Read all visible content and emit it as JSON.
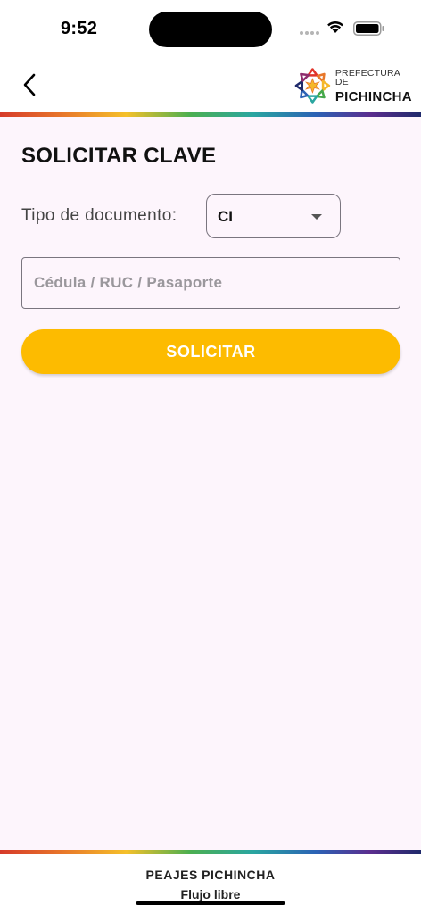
{
  "status_bar": {
    "time": "9:52"
  },
  "header": {
    "logo": {
      "line1": "PREFECTURA DE",
      "line2": "PICHINCHA"
    }
  },
  "form": {
    "title": "SOLICITAR CLAVE",
    "doc_type_label": "Tipo de documento:",
    "doc_type_value": "CI",
    "id_placeholder": "Cédula / RUC / Pasaporte",
    "submit_label": "SOLICITAR"
  },
  "footer": {
    "title": "PEAJES PICHINCHA",
    "subtitle": "Flujo libre"
  },
  "colors": {
    "background": "#fdf5fc",
    "accent": "#fdbb00",
    "border": "#7a757f",
    "placeholder": "#9a979c"
  },
  "icons": {
    "back": "chevron-left-icon",
    "dropdown": "caret-down-icon",
    "wifi": "wifi-icon",
    "battery": "battery-icon",
    "logo": "prefectura-star-logo-icon"
  }
}
